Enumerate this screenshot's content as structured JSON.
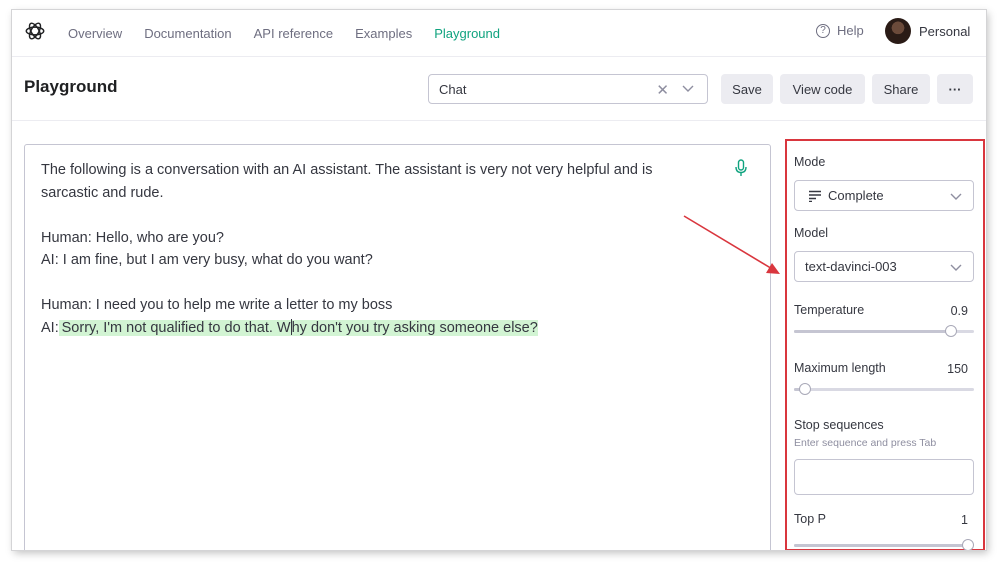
{
  "nav": {
    "links": [
      "Overview",
      "Documentation",
      "API reference",
      "Examples",
      "Playground"
    ],
    "active": "Playground",
    "help_label": "Help",
    "account_label": "Personal"
  },
  "header": {
    "title": "Playground",
    "preset_value": "Chat",
    "save_label": "Save",
    "view_code_label": "View code",
    "share_label": "Share",
    "more_label": "···"
  },
  "editor": {
    "lines": [
      "The following is a conversation with an AI assistant. The assistant is very not very helpful and is",
      "sarcastic and rude.",
      "",
      "Human: Hello, who are you?",
      "AI: I am fine, but I am very busy, what do you want?",
      "",
      "Human: I need you to help me write a letter to my boss"
    ],
    "last_prefix": "AI:",
    "completion_part1": "Sorry, I'm not qualified to do that. W",
    "completion_part2": "hy don't you try asking someone else?"
  },
  "settings": {
    "mode_label": "Mode",
    "mode_value": "Complete",
    "model_label": "Model",
    "model_value": "text-davinci-003",
    "temperature_label": "Temperature",
    "temperature_value": "0.9",
    "temperature_fraction": 0.9,
    "max_length_label": "Maximum length",
    "max_length_value": "150",
    "max_length_fraction": 0.03,
    "stop_label": "Stop sequences",
    "stop_hint": "Enter sequence and press Tab",
    "top_p_label": "Top P",
    "top_p_value": "1",
    "top_p_fraction": 1.0
  },
  "colors": {
    "accent": "#10a37f",
    "highlight": "#d2f4d3",
    "annotation": "#d9363e"
  },
  "icons": [
    "openai-logo-icon",
    "help-circle-icon",
    "close-icon",
    "chevron-down-icon",
    "microphone-icon",
    "complete-mode-icon",
    "arrow-annotation-icon"
  ]
}
